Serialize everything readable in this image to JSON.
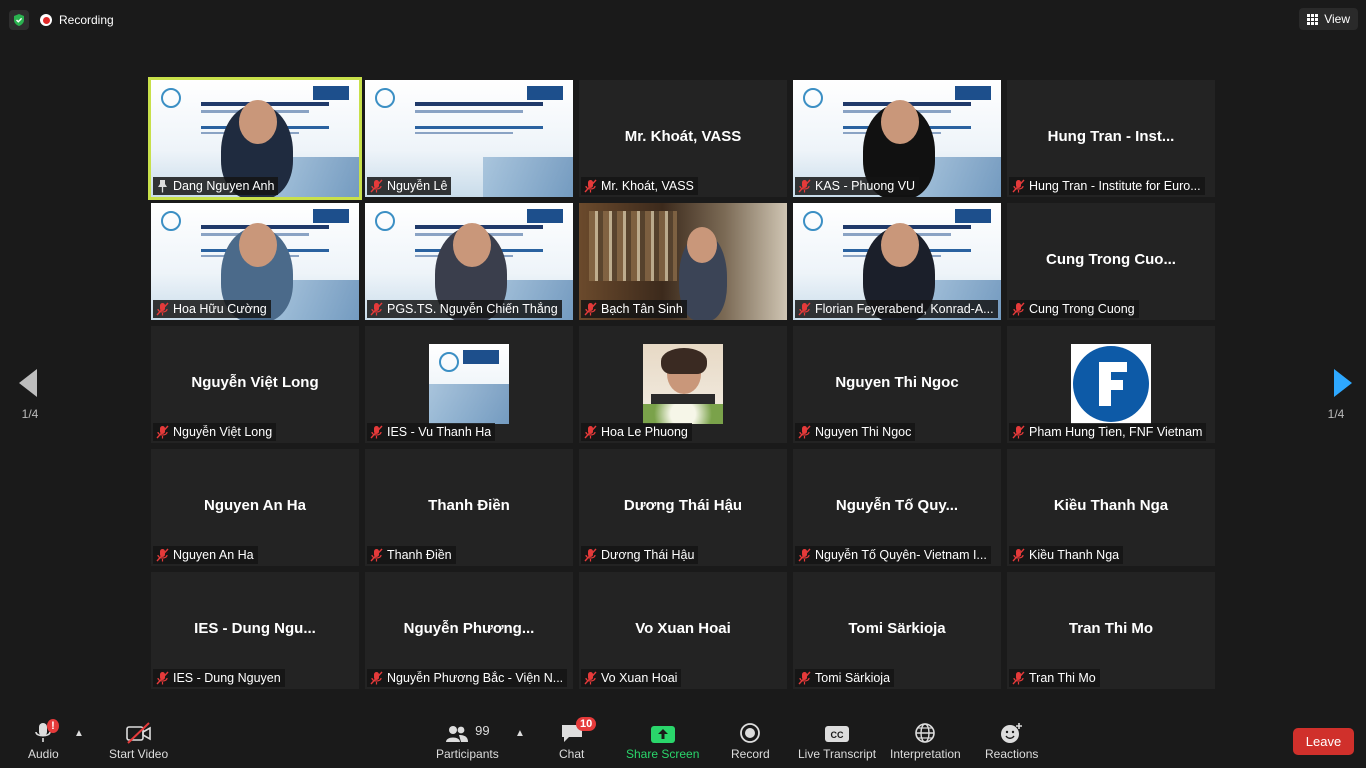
{
  "top": {
    "recording_label": "Recording",
    "view_label": "View"
  },
  "pagination": {
    "left": "1/4",
    "right": "1/4"
  },
  "tiles": [
    {
      "label": "Dang Nguyen Anh",
      "big": "",
      "video": "slide-person"
    },
    {
      "label": "Nguyễn Lê",
      "big": "",
      "video": "slide"
    },
    {
      "label": "Mr. Khoát, VASS",
      "big": "Mr. Khoát, VASS",
      "video": "none"
    },
    {
      "label": "KAS - Phuong VU",
      "big": "",
      "video": "slide-person"
    },
    {
      "label": "Hung Tran - Institute for Euro...",
      "big": "Hung Tran - Inst...",
      "video": "none"
    },
    {
      "label": "Hoa Hữu Cường",
      "big": "",
      "video": "slide-person"
    },
    {
      "label": "PGS.TS. Nguyễn Chiến Thắng",
      "big": "",
      "video": "slide-person"
    },
    {
      "label": "Bạch Tân Sinh",
      "big": "",
      "video": "room"
    },
    {
      "label": "Florian Feyerabend, Konrad-A...",
      "big": "",
      "video": "slide-person"
    },
    {
      "label": "Cung Trong Cuong",
      "big": "Cung Trong Cuo...",
      "video": "none"
    },
    {
      "label": "Nguyễn Việt Long",
      "big": "Nguyễn Việt Long",
      "video": "none"
    },
    {
      "label": "IES - Vu Thanh Ha",
      "big": "",
      "video": "avatar-slide"
    },
    {
      "label": "Hoa Le Phuong",
      "big": "",
      "video": "avatar-photo"
    },
    {
      "label": "Nguyen Thi Ngoc",
      "big": "Nguyen Thi Ngoc",
      "video": "none"
    },
    {
      "label": "Pham Hung Tien, FNF Vietnam",
      "big": "",
      "video": "avatar-logo"
    },
    {
      "label": "Nguyen An Ha",
      "big": "Nguyen An Ha",
      "video": "none"
    },
    {
      "label": "Thanh Điền",
      "big": "Thanh Điền",
      "video": "none"
    },
    {
      "label": "Dương Thái Hậu",
      "big": "Dương Thái Hậu",
      "video": "none"
    },
    {
      "label": "Nguyễn Tố Quyên- Vietnam I...",
      "big": "Nguyễn Tố Quy...",
      "video": "none"
    },
    {
      "label": "Kiều Thanh Nga",
      "big": "Kiều Thanh Nga",
      "video": "none"
    },
    {
      "label": "IES - Dung Nguyen",
      "big": "IES - Dung Ngu...",
      "video": "none"
    },
    {
      "label": "Nguyễn Phương Bắc - Viện N...",
      "big": "Nguyễn Phương...",
      "video": "none"
    },
    {
      "label": "Vo Xuan Hoai",
      "big": "Vo Xuan Hoai",
      "video": "none"
    },
    {
      "label": "Tomi Särkioja",
      "big": "Tomi Särkioja",
      "video": "none"
    },
    {
      "label": "Tran Thi Mo",
      "big": "Tran Thi Mo",
      "video": "none"
    }
  ],
  "toolbar": {
    "audio": "Audio",
    "start_video": "Start Video",
    "participants": "Participants",
    "participants_count": "99",
    "chat": "Chat",
    "chat_badge": "10",
    "audio_badge": "!",
    "share_screen": "Share Screen",
    "record": "Record",
    "live_transcript": "Live Transcript",
    "interpretation": "Interpretation",
    "reactions": "Reactions",
    "leave": "Leave"
  },
  "colors": {
    "active_speaker": "#c8e04a",
    "share_green": "#2ad66b",
    "leave_red": "#d0302b",
    "nav_arrow": "#2ea8ff"
  }
}
